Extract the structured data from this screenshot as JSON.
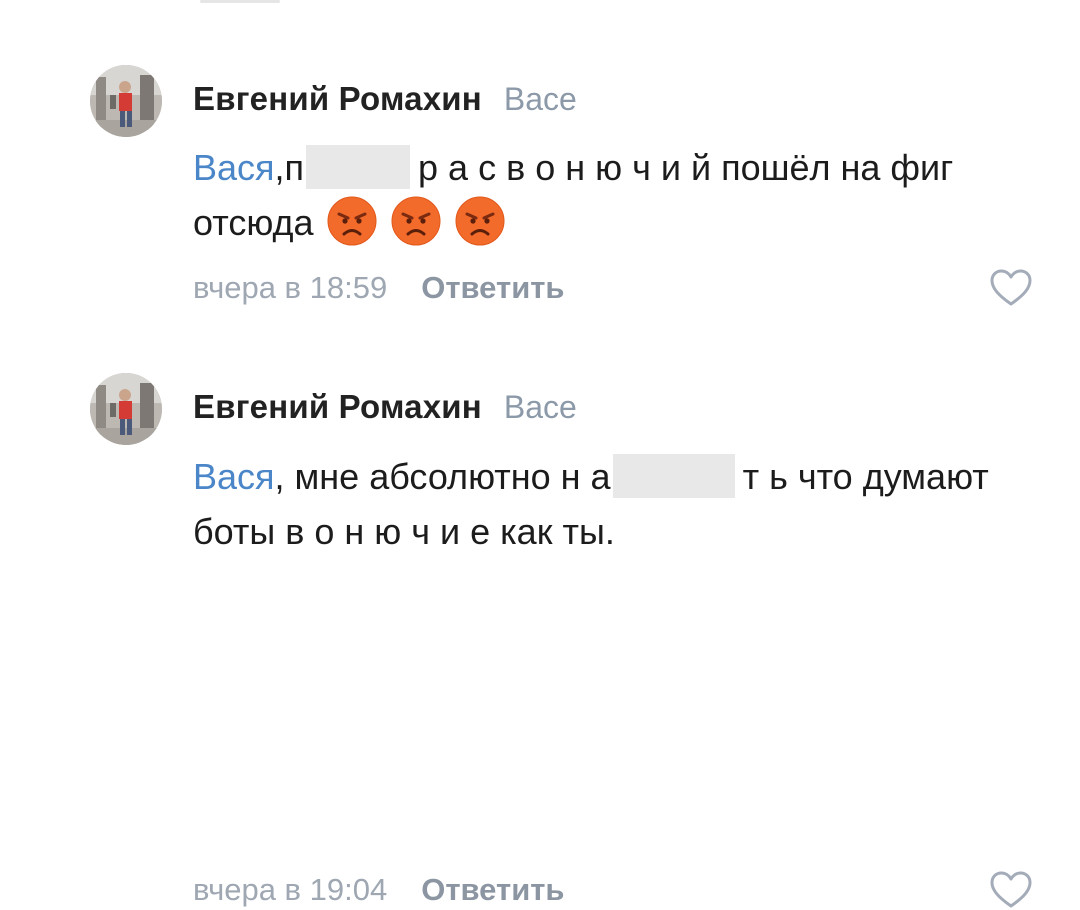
{
  "comments": [
    {
      "author": "Евгений Ромахин",
      "reply_to": "Васе",
      "mention": "Вася",
      "text_part1": ",п",
      "text_part2": "р а с  в о н ю ч и й пошёл на фиг отсюда",
      "emojis": [
        "angry-face-icon",
        "angry-face-icon",
        "angry-face-icon"
      ],
      "time": "вчера в 18:59",
      "reply_label": "Ответить"
    },
    {
      "author": "Евгений Ромахин",
      "reply_to": "Васе",
      "mention": "Вася",
      "text_part1": ", мне абсолютно н а",
      "text_part2": "т ь что думают боты в о н ю ч и е как ты.",
      "time": "вчера в 19:04",
      "reply_label": "Ответить"
    }
  ],
  "colors": {
    "mention": "#4a86c8",
    "meta": "#9ea7b2",
    "redaction": "#e8e8e9",
    "emoji": "#f26b2a"
  }
}
